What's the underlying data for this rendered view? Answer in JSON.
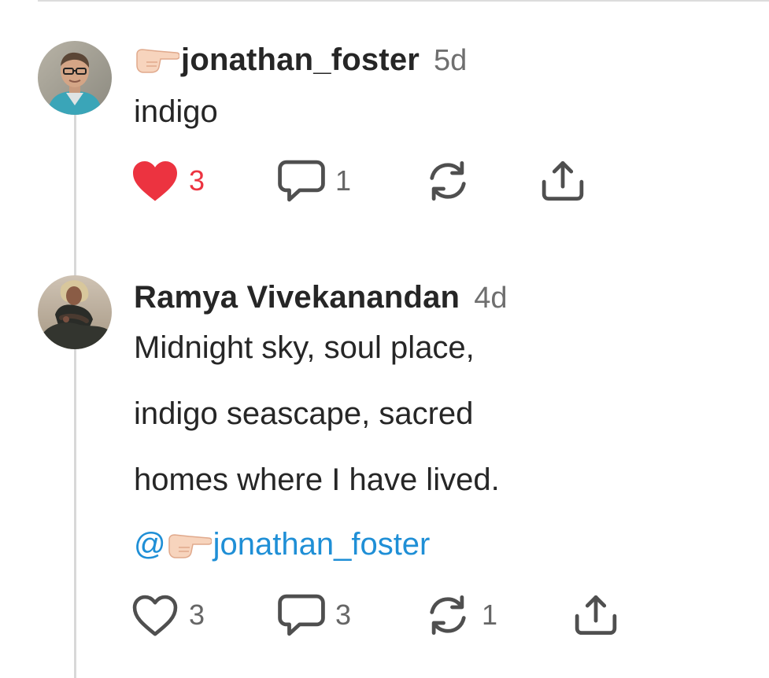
{
  "posts": [
    {
      "author": "jonathan_foster",
      "author_emoji": "backhand-index-pointing-right",
      "timestamp": "5d",
      "body": [
        "indigo"
      ],
      "likes": "3",
      "liked": true,
      "replies": "1",
      "reposts": "",
      "avatar": "man-with-glasses-avatar"
    },
    {
      "author": "Ramya Vivekanandan",
      "timestamp": "4d",
      "body": [
        "Midnight sky, soul place,",
        "indigo seascape, sacred",
        "homes where I have lived."
      ],
      "mention": {
        "prefix": "@",
        "emoji": "backhand-index-pointing-right",
        "handle": "jonathan_foster"
      },
      "likes": "3",
      "liked": false,
      "replies": "3",
      "reposts": "1",
      "avatar": "woman-seated-avatar"
    }
  ],
  "colors": {
    "like_active": "#ec3340",
    "mention": "#1f8fd6",
    "icon_gray": "#555555",
    "thread_line": "#d8d8d8"
  }
}
